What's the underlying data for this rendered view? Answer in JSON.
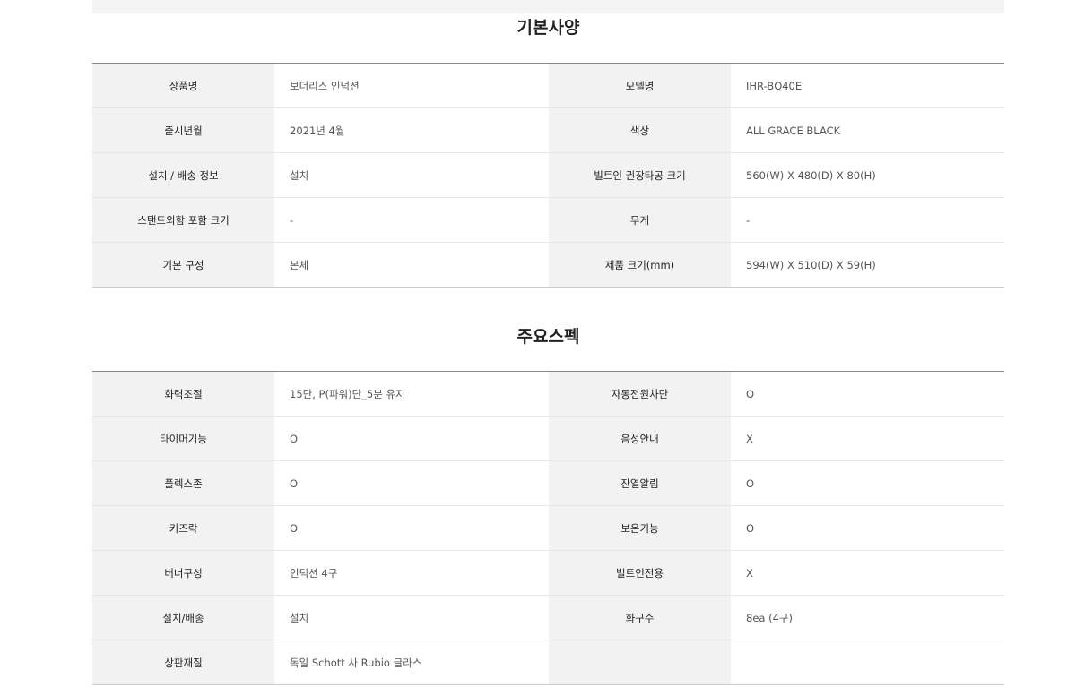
{
  "basic": {
    "title": "기본사양",
    "rows": [
      {
        "l_label": "상품명",
        "l_value": "보더리스 인덕션",
        "r_label": "모델명",
        "r_value": "IHR-BQ40E"
      },
      {
        "l_label": "출시년월",
        "l_value": "2021년 4월",
        "r_label": "색상",
        "r_value": "ALL GRACE BLACK"
      },
      {
        "l_label": "설치 / 배송 정보",
        "l_value": "설치",
        "r_label": "빌트인 권장타공 크기",
        "r_value": "560(W) X 480(D) X 80(H)"
      },
      {
        "l_label": "스탠드외함 포함 크기",
        "l_value": "-",
        "r_label": "무게",
        "r_value": "-"
      },
      {
        "l_label": "기본 구성",
        "l_value": "본체",
        "r_label": "제품 크기(mm)",
        "r_value": "594(W) X 510(D) X 59(H)"
      }
    ]
  },
  "main_spec": {
    "title": "주요스펙",
    "rows": [
      {
        "l_label": "화력조절",
        "l_value": "15단, P(파워)단_5분 유지",
        "r_label": "자동전원차단",
        "r_value": "O"
      },
      {
        "l_label": "타이머기능",
        "l_value": "O",
        "r_label": "음성안내",
        "r_value": "X"
      },
      {
        "l_label": "플렉스존",
        "l_value": "O",
        "r_label": "잔열알림",
        "r_value": "O"
      },
      {
        "l_label": "키즈락",
        "l_value": "O",
        "r_label": "보온기능",
        "r_value": "O"
      },
      {
        "l_label": "버너구성",
        "l_value": "인덕션 4구",
        "r_label": "빌트인전용",
        "r_value": "X"
      },
      {
        "l_label": "설치/배송",
        "l_value": "설치",
        "r_label": "화구수",
        "r_value": "8ea (4구)"
      },
      {
        "l_label": "상판재질",
        "l_value": "독일 Schott 사 Rubio 글라스",
        "r_label": "",
        "r_value": ""
      }
    ]
  }
}
